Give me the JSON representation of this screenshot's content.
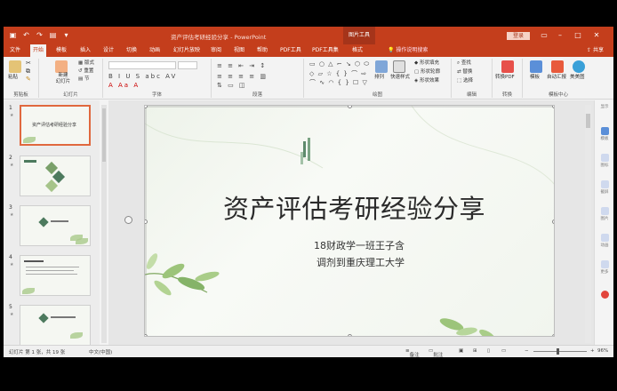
{
  "window": {
    "title": "资产评估考研经验分享 - PowerPoint",
    "context_tab_group": "图片工具",
    "login": "登录"
  },
  "tabs": [
    {
      "label": "文件"
    },
    {
      "label": "开始"
    },
    {
      "label": "模板"
    },
    {
      "label": "插入"
    },
    {
      "label": "设计"
    },
    {
      "label": "切换"
    },
    {
      "label": "动画"
    },
    {
      "label": "幻灯片放映"
    },
    {
      "label": "审阅"
    },
    {
      "label": "视图"
    },
    {
      "label": "帮助"
    },
    {
      "label": "PDF工具"
    },
    {
      "label": "PDF工具集"
    },
    {
      "label": "格式"
    }
  ],
  "tell_me": "操作说明搜索",
  "share": "共享",
  "ribbon": {
    "clipboard": {
      "label": "剪贴板",
      "paste": "粘贴"
    },
    "slides": {
      "label": "幻灯片",
      "new_slide": "新建\n幻灯片",
      "layout": "版式",
      "reset": "重置",
      "section": "节"
    },
    "font": {
      "label": "字体"
    },
    "paragraph": {
      "label": "段落"
    },
    "drawing": {
      "label": "绘图",
      "arrange": "排列",
      "quick_styles": "快速样式",
      "shape_fill": "形状填充",
      "shape_outline": "形状轮廓",
      "shape_effects": "形状效果"
    },
    "editing": {
      "label": "编辑",
      "find": "查找",
      "replace": "替换",
      "select": "选择"
    },
    "convert": {
      "label": "转换",
      "to_pdf": "转换PDF"
    },
    "template_center": {
      "label": "模板中心",
      "templates": "模板",
      "auto_report": "自动汇报",
      "wps": "美美图"
    }
  },
  "thumbnails": [
    {
      "num": "1",
      "title": "资产评估考研经验分享",
      "selected": true
    },
    {
      "num": "2",
      "title": "",
      "selected": false
    },
    {
      "num": "3",
      "title": "",
      "selected": false
    },
    {
      "num": "4",
      "title": "",
      "selected": false
    },
    {
      "num": "5",
      "title": "",
      "selected": false
    }
  ],
  "slide": {
    "title": "资产评估考研经验分享",
    "line1": "18财政学一班王子含",
    "line2": "调剂到重庆理工大学"
  },
  "right_sidebar": [
    {
      "label": "显示"
    },
    {
      "label": "模板"
    },
    {
      "label": "图标"
    },
    {
      "label": "截屏"
    },
    {
      "label": "图片"
    },
    {
      "label": "动画"
    },
    {
      "label": "更多"
    }
  ],
  "status": {
    "slide_info": "幻灯片 第 1 张，共 19 张",
    "language": "中文(中国)",
    "notes": "备注",
    "comments": "批注",
    "zoom": "96%"
  },
  "colors": {
    "accent": "#c43e1c",
    "selected_thumb": "#e0683e"
  }
}
